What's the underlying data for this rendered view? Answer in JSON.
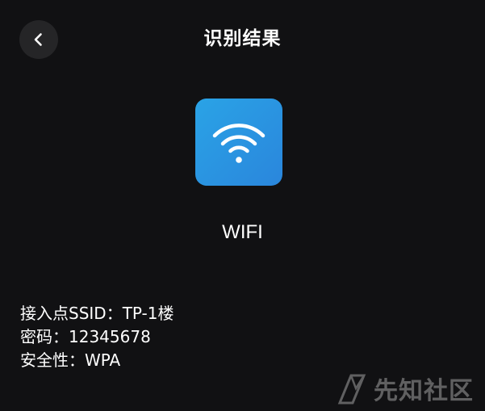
{
  "header": {
    "title": "识别结果",
    "back_icon": "chevron-left-icon"
  },
  "result": {
    "icon": "wifi-icon",
    "icon_color": "#2a95e2",
    "type_label": "WIFI"
  },
  "details": {
    "ssid": "接入点SSID：TP-1楼",
    "password": "密码：12345678",
    "security": "安全性：WPA"
  },
  "watermark": {
    "text": "先知社区",
    "logo_icon": "xianzhi-logo-icon"
  },
  "colors": {
    "background": "#111113",
    "back_button_bg": "#252527",
    "text": "#ffffff"
  }
}
